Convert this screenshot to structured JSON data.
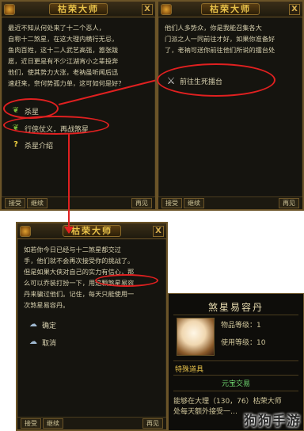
{
  "panel_left": {
    "title": "枯荣大师",
    "close": "X",
    "text": "最近不知从何处来了十二个恶人，\n自称十二煞星，在这大理内横行无忌，\n鱼肉百姓，这十二人武艺高强，嚣张跋\n扈，近日更是有不少江湖宵小之辈投奔\n他们，使其势力大涨，老衲虽听闻后迅\n速赶来，奈何势孤力单，这可如何是好？",
    "options": [
      {
        "icon": "leaf-icon",
        "label": "杀星"
      },
      {
        "icon": "leaf-icon",
        "label": "行侠仗义，再战煞星"
      },
      {
        "icon": "question-icon",
        "label": "杀星介绍"
      }
    ],
    "tabs": [
      "接受",
      "继续"
    ],
    "return": "再见"
  },
  "panel_right": {
    "title": "枯荣大师",
    "close": "X",
    "text": "他们人多势众，你是我能召集各大\n门派之人一同前往才好，如果你准备好\n了，老衲可送你前往他们所说的擂台处",
    "options": [
      {
        "icon": "sword-icon",
        "label": "前往生死擂台"
      }
    ],
    "tabs": [
      "接受",
      "继续"
    ],
    "return": "再见"
  },
  "panel_bottom": {
    "title": "枯荣大师",
    "close": "X",
    "text": "如若你今日已经与十二煞星都交过\n手，他们就不会再次接受你的挑战了。\n但是如果大侠对自己的实力有信心，那\n么可以乔装打扮一下，用这颗煞星易容\n丹来骗过他们。记住，每天只能使用一\n次煞星易容丹。",
    "options": [
      {
        "icon": "chat-icon",
        "label": "确定"
      },
      {
        "icon": "chat-icon",
        "label": "取消"
      }
    ],
    "tabs": [
      "接受",
      "继续"
    ],
    "return": "再见"
  },
  "tooltip": {
    "title": "煞星易容丹",
    "level_label": "物品等级：1",
    "use_level": "使用等级：10",
    "section": "特殊道具",
    "trade": "元宝交易",
    "desc_line1": "能够在大理（130，76）枯荣大师",
    "desc_line2": "处每天额外接受一…"
  },
  "watermark": "狗狗手游",
  "colors": {
    "annotation": "#e02020",
    "gold": "#e8c24a"
  }
}
